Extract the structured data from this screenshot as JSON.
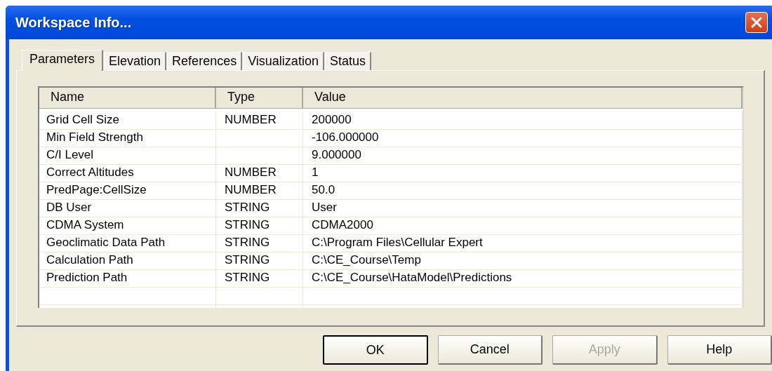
{
  "window": {
    "title": "Workspace Info..."
  },
  "tabs": [
    {
      "label": "Parameters",
      "selected": true
    },
    {
      "label": "Elevation",
      "selected": false
    },
    {
      "label": "References",
      "selected": false
    },
    {
      "label": "Visualization",
      "selected": false
    },
    {
      "label": "Status",
      "selected": false
    }
  ],
  "table": {
    "columns": [
      "Name",
      "Type",
      "Value"
    ],
    "rows": [
      [
        "Grid Cell Size",
        "NUMBER",
        "200000"
      ],
      [
        "Min Field Strength",
        "",
        "-106.000000"
      ],
      [
        "C/I Level",
        "",
        "9.000000"
      ],
      [
        "Correct Altitudes",
        "NUMBER",
        "1"
      ],
      [
        "PredPage:CellSize",
        "NUMBER",
        "50.0"
      ],
      [
        "DB User",
        "STRING",
        "User"
      ],
      [
        "CDMA System",
        "STRING",
        "CDMA2000"
      ],
      [
        "Geoclimatic Data Path",
        "STRING",
        "C:\\Program Files\\Cellular Expert"
      ],
      [
        "Calculation Path",
        "STRING",
        "C:\\CE_Course\\Temp"
      ],
      [
        "Prediction Path",
        "STRING",
        "C:\\CE_Course\\HataModel\\Predictions"
      ]
    ]
  },
  "buttons": [
    {
      "label": "OK",
      "default": true,
      "disabled": false
    },
    {
      "label": "Cancel",
      "default": false,
      "disabled": false
    },
    {
      "label": "Apply",
      "default": false,
      "disabled": true
    },
    {
      "label": "Help",
      "default": false,
      "disabled": false
    }
  ]
}
